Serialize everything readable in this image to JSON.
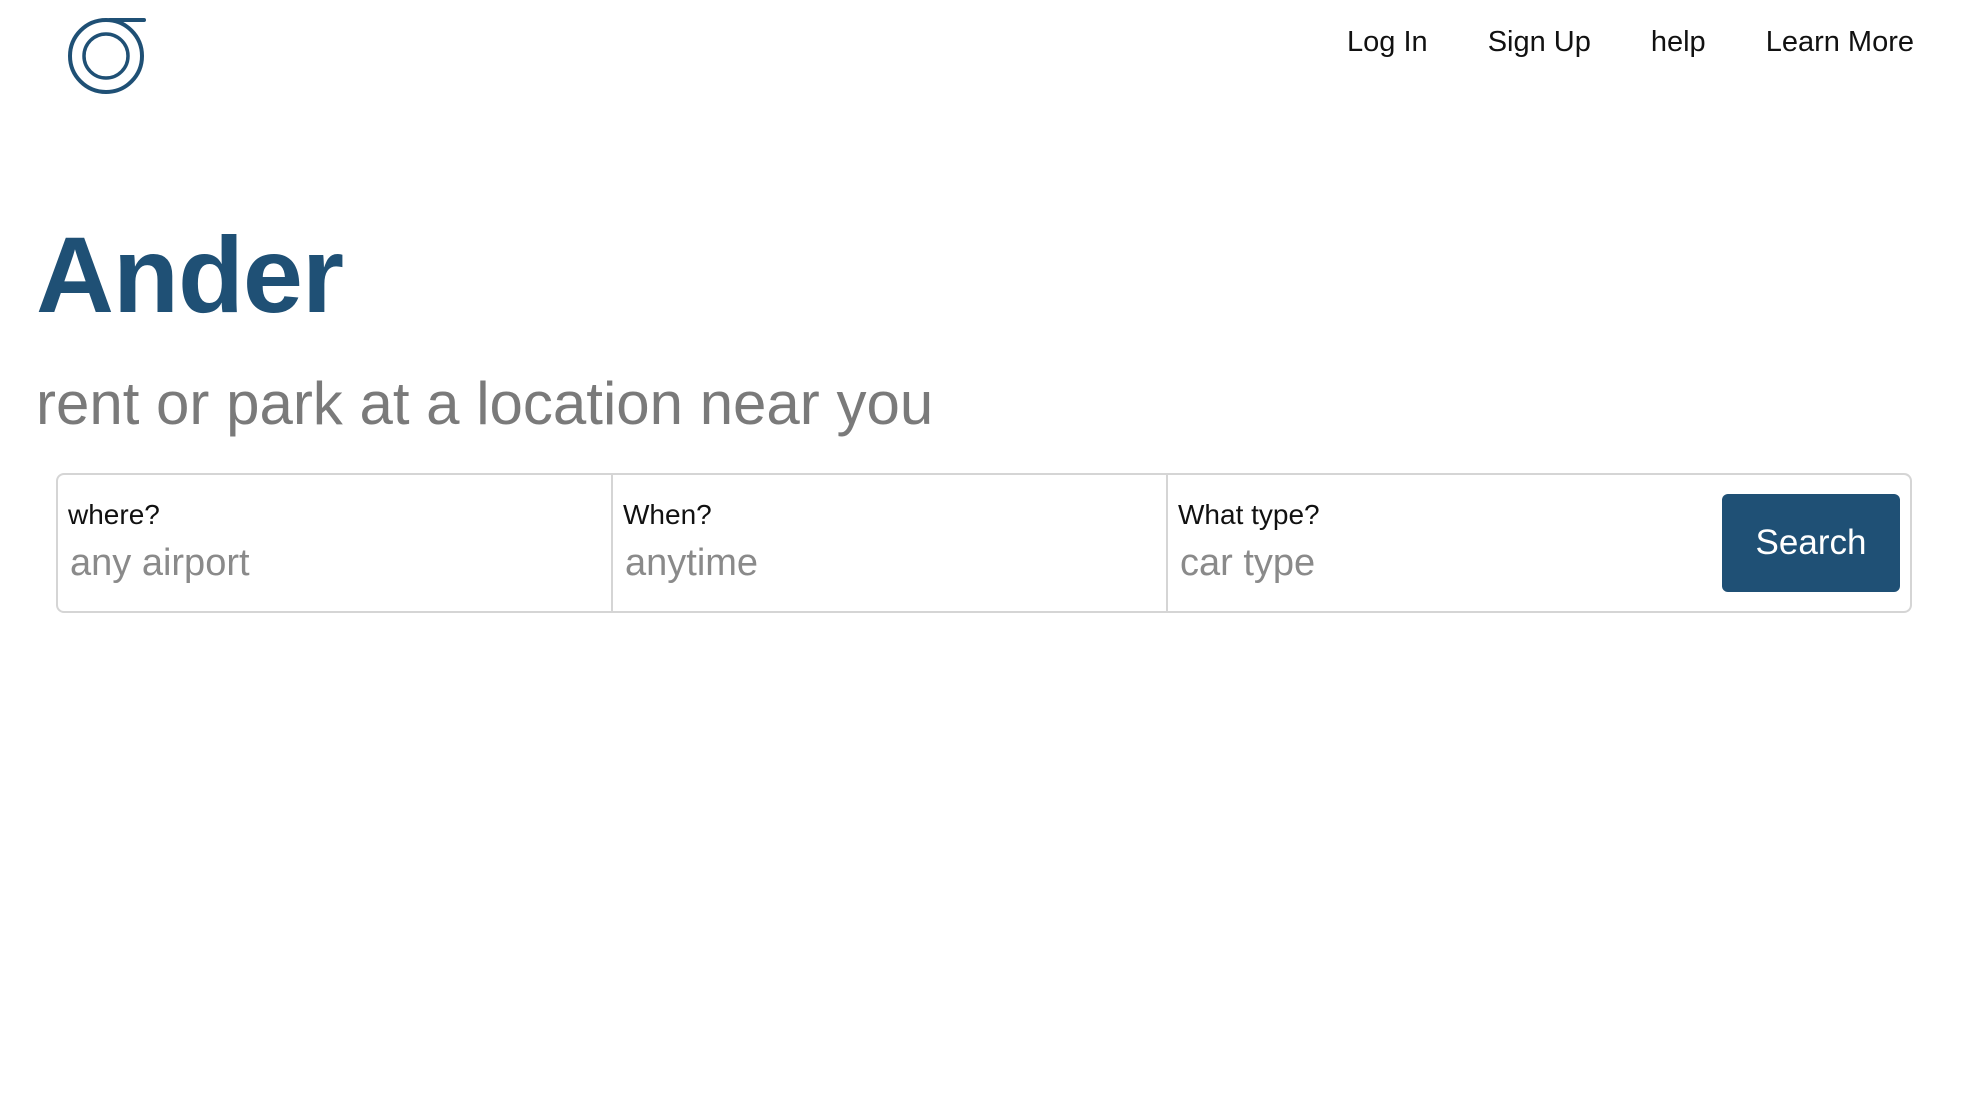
{
  "header": {
    "logo_icon": "ander-logo-icon",
    "nav": {
      "login": "Log In",
      "signup": "Sign Up",
      "help": "help",
      "learn_more": "Learn More"
    }
  },
  "hero": {
    "title": "Ander",
    "tagline": "rent or park at a location near you"
  },
  "search": {
    "where": {
      "label": "where?",
      "placeholder": "any airport",
      "value": ""
    },
    "when": {
      "label": "When?",
      "placeholder": "anytime",
      "value": ""
    },
    "type": {
      "label": "What type?",
      "placeholder": "car type",
      "value": ""
    },
    "button_label": "Search"
  },
  "colors": {
    "brand": "#1f5075",
    "muted_text": "#7a7a7a",
    "border": "#d5d5d5"
  }
}
